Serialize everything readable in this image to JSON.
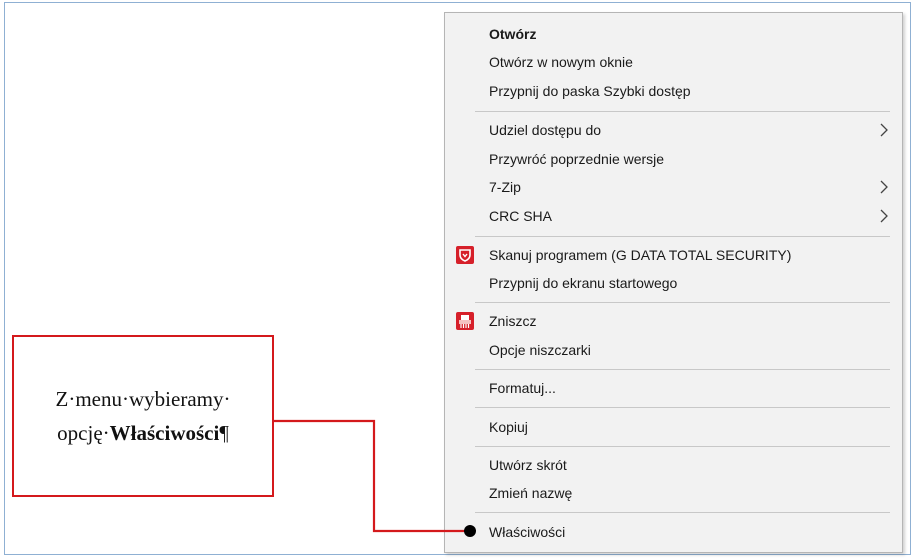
{
  "menu": {
    "items": [
      {
        "label": "Otwórz"
      },
      {
        "label": "Otwórz w nowym oknie"
      },
      {
        "label": "Przypnij do paska Szybki dostęp"
      },
      {
        "label": "Udziel dostępu do"
      },
      {
        "label": "Przywróć poprzednie wersje"
      },
      {
        "label": "7-Zip"
      },
      {
        "label": "CRC SHA"
      },
      {
        "label": "Skanuj programem (G DATA TOTAL SECURITY)"
      },
      {
        "label": "Przypnij do ekranu startowego"
      },
      {
        "label": "Zniszcz"
      },
      {
        "label": "Opcje niszczarki"
      },
      {
        "label": "Formatuj..."
      },
      {
        "label": "Kopiuj"
      },
      {
        "label": "Utwórz skrót"
      },
      {
        "label": "Zmień nazwę"
      },
      {
        "label": "Właściwości"
      }
    ],
    "icons": {
      "gdata": "gdata-shield-icon",
      "shredder": "shredder-icon",
      "submenu": "chevron-right-icon"
    }
  },
  "callout": {
    "line1": "Z·menu·wybieramy·",
    "line2_prefix": "opcję·",
    "line2_bold": "Właściwości",
    "line2_suffix": "¶"
  },
  "colors": {
    "callout_border": "#d4191c",
    "connector": "#d4191c",
    "gdata_red": "#d6202a"
  }
}
